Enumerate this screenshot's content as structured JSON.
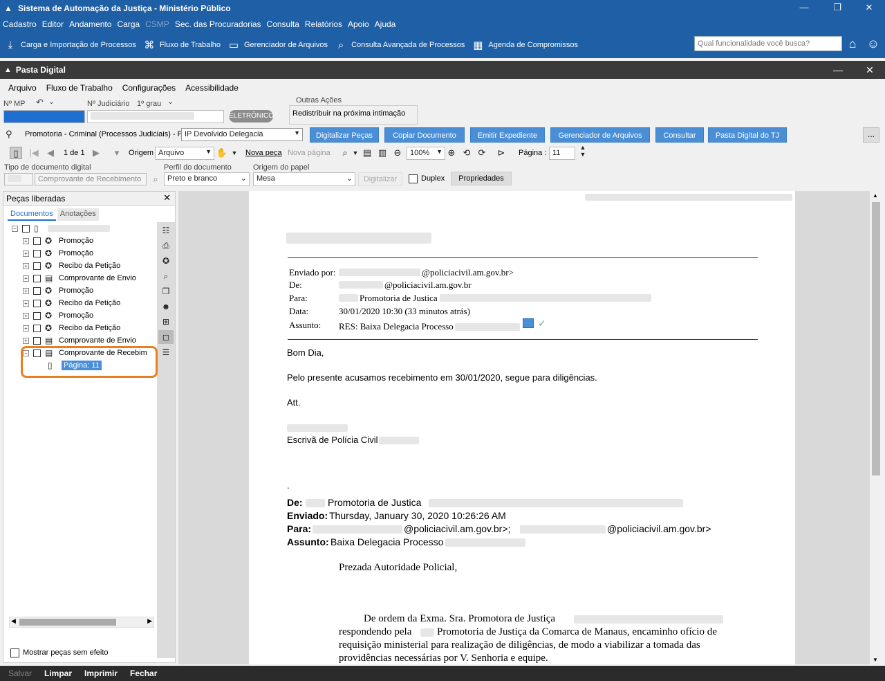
{
  "app": {
    "title": "Sistema de Automação da Justiça - Ministério Público"
  },
  "menu": [
    "Cadastro",
    "Editor",
    "Andamento",
    "Carga",
    "CSMP",
    "Sec. das Procuradorias",
    "Consulta",
    "Relatórios",
    "Apoio",
    "Ajuda"
  ],
  "shortcuts": [
    {
      "label": "Carga e Importação de Processos",
      "icon": "download-arrow-icon"
    },
    {
      "label": "Fluxo de Trabalho",
      "icon": "workflow-icon"
    },
    {
      "label": "Gerenciador de Arquivos",
      "icon": "file-manager-icon"
    },
    {
      "label": "Consulta Avançada de Processos",
      "icon": "advanced-search-icon"
    },
    {
      "label": "Agenda de Compromissos",
      "icon": "calendar-icon"
    }
  ],
  "search": {
    "placeholder": "Qual funcionalidade você busca?"
  },
  "child": {
    "title": "Pasta Digital",
    "menu": [
      "Arquivo",
      "Fluxo de Trabalho",
      "Configurações",
      "Acessibilidade"
    ],
    "labels": {
      "nmp": "Nº MP",
      "njud": "Nº Judiciário",
      "grau": "1º grau",
      "badge": "ELETRÔNICO",
      "outras_title": "Outras Ações",
      "outras_value": "Redistribuir na próxima intimação",
      "fila_label": "Promotoria - Criminal (Processos Judiciais) - Fila",
      "fila_value": "IP Devolvido Delegacia"
    },
    "actions": [
      "Digitalizar Peças",
      "Copiar Documento",
      "Emitir Expediente",
      "Gerenciador de Arquivos",
      "Consultar",
      "Pasta Digital do TJ"
    ],
    "toolbar": {
      "pages": "1 de 1",
      "origem_label": "Origem",
      "origem_value": "Arquivo",
      "nova_peca": "Nova peça",
      "nova_pagina": "Nova página",
      "zoom": "100%",
      "pagina_label": "Página :",
      "pagina_value": "11"
    },
    "fields": {
      "tipo_label": "Tipo de documento digital",
      "tipo_value": "Comprovante de Recebimento",
      "perfil_label": "Perfil do documento",
      "perfil_value": "Preto e branco",
      "origem_papel_label": "Origem do papel",
      "origem_papel_value": "Mesa",
      "digitalizar": "Digitalizar",
      "duplex": "Duplex",
      "propriedades": "Propriedades"
    }
  },
  "left_panel": {
    "title": "Peças liberadas",
    "tabs": [
      "Documentos",
      "Anotações"
    ],
    "items": [
      "Promoção",
      "Promoção",
      "Recibo da Petição",
      "Comprovante de Envio",
      "Promoção",
      "Recibo da Petição",
      "Promoção",
      "Recibo da Petição",
      "Comprovante de Envio",
      "Comprovante de Recebim"
    ],
    "sub_item": "Página: 11",
    "show_no_effect": "Mostrar peças sem efeito"
  },
  "document": {
    "header": {
      "sent_by_label": "Enviado por:",
      "sent_by_value": "@policiacivil.am.gov.br>",
      "from_label": "De:",
      "from_value": "@policiacivil.am.gov.br",
      "to_label": "Para:",
      "to_value": "Promotoria de Justica",
      "date_label": "Data:",
      "date_value": "30/01/2020 10:30 (33 minutos atrás)",
      "subject_label": "Assunto:",
      "subject_value": "RES: Baixa Delegacia Processo"
    },
    "body": {
      "greeting": "Bom Dia,",
      "line1": "Pelo presente acusamos recebimento em 30/01/2020, segue para diligências.",
      "att": "Att.",
      "signature": "Escrivã de Polícia Civil",
      "dot": "."
    },
    "forward": {
      "from_label": "De:",
      "from_value": "Promotoria de Justica",
      "sent_label": "Enviado:",
      "sent_value": "Thursday, January 30, 2020 10:26:26 AM",
      "to_label": "Para:",
      "to_value1": "@policiacivil.am.gov.br>;",
      "to_value2": "@policiacivil.am.gov.br>",
      "subject_label": "Assunto:",
      "subject_value": "Baixa Delegacia Processo"
    },
    "letter": {
      "salutation": "Prezada Autoridade Policial,",
      "p1_a": "De ordem da Exma. Sra.  Promotora de Justiça",
      "p1_b": "respondendo pela",
      "p1_c": "Promotoria de Justiça da Comarca de Manaus, encaminho ofício de",
      "p1_d": "requisição ministerial para realização de diligências, de modo a viabilizar a tomada das",
      "p1_e": "providências necessárias por V. Senhoria e equipe."
    }
  },
  "bottom": [
    "Salvar",
    "Limpar",
    "Imprimir",
    "Fechar"
  ],
  "colors": {
    "accent": "#1f5fa5",
    "button": "#4a8ed6",
    "highlight": "#e8801f"
  }
}
